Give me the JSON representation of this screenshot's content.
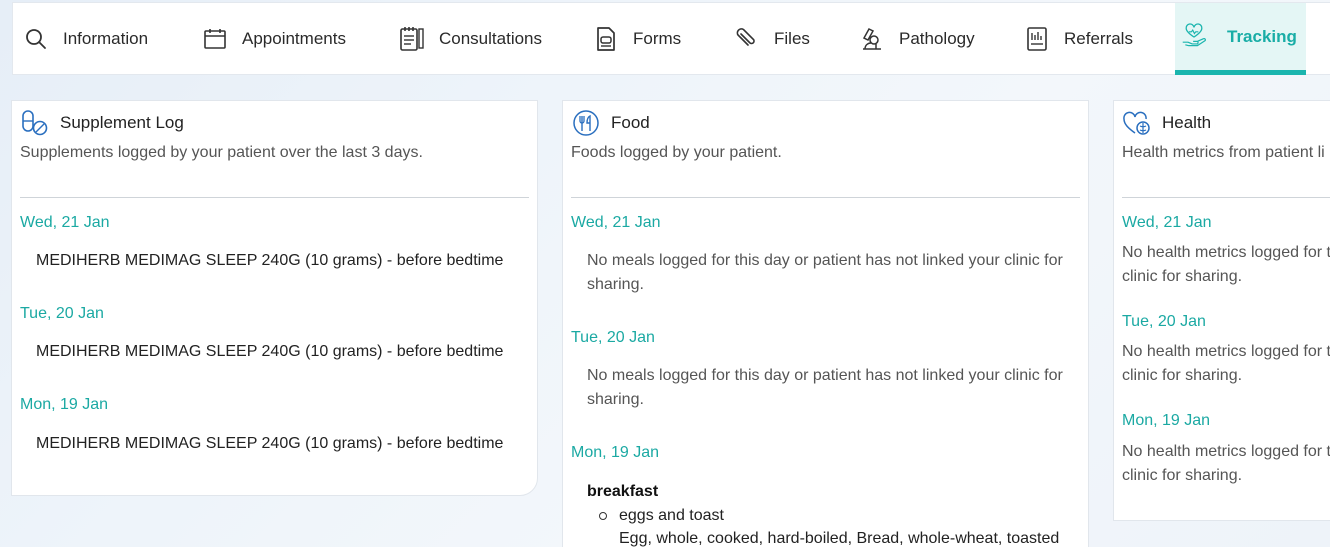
{
  "nav": {
    "tabs": [
      {
        "label": "Information",
        "icon": "search-icon"
      },
      {
        "label": "Appointments",
        "icon": "calendar-icon"
      },
      {
        "label": "Consultations",
        "icon": "notepad-icon"
      },
      {
        "label": "Forms",
        "icon": "form-icon"
      },
      {
        "label": "Files",
        "icon": "paperclip-icon"
      },
      {
        "label": "Pathology",
        "icon": "microscope-icon"
      },
      {
        "label": "Referrals",
        "icon": "document-icon"
      },
      {
        "label": "Tracking",
        "icon": "heart-hand-icon"
      }
    ],
    "active_tab": "Tracking",
    "accent": "#1bb5ae"
  },
  "supplement": {
    "title": "Supplement Log",
    "subtitle": "Supplements logged by your patient over the last 3 days.",
    "days": [
      {
        "date": "Wed, 21 Jan",
        "entry": "MEDIHERB MEDIMAG SLEEP 240G (10 grams) - before bedtime"
      },
      {
        "date": "Tue, 20 Jan",
        "entry": "MEDIHERB MEDIMAG SLEEP 240G (10 grams) - before bedtime"
      },
      {
        "date": "Mon, 19 Jan",
        "entry": "MEDIHERB MEDIMAG SLEEP 240G (10 grams) - before bedtime"
      }
    ]
  },
  "food": {
    "title": "Food",
    "subtitle": "Foods logged by your patient.",
    "days": [
      {
        "date": "Wed, 21 Jan",
        "note_line1": "No meals logged for this day or patient has not linked your clinic for",
        "note_line2": "sharing."
      },
      {
        "date": "Tue, 20 Jan",
        "note_line1": "No meals logged for this day or patient has not linked your clinic for",
        "note_line2": "sharing."
      },
      {
        "date": "Mon, 19 Jan",
        "meal": "breakfast",
        "item": "eggs and toast",
        "item_desc": "Egg, whole, cooked, hard-boiled, Bread, whole-wheat, toasted"
      }
    ]
  },
  "health": {
    "title": "Health",
    "subtitle": "Health metrics from patient li",
    "days": [
      {
        "date": "Wed, 21 Jan",
        "note_line1": "No health metrics logged for t",
        "note_line2": "clinic for sharing."
      },
      {
        "date": "Tue, 20 Jan",
        "note_line1": "No health metrics logged for t",
        "note_line2": "clinic for sharing."
      },
      {
        "date": "Mon, 19 Jan",
        "note_line1": "No health metrics logged for t",
        "note_line2": "clinic for sharing."
      }
    ]
  }
}
